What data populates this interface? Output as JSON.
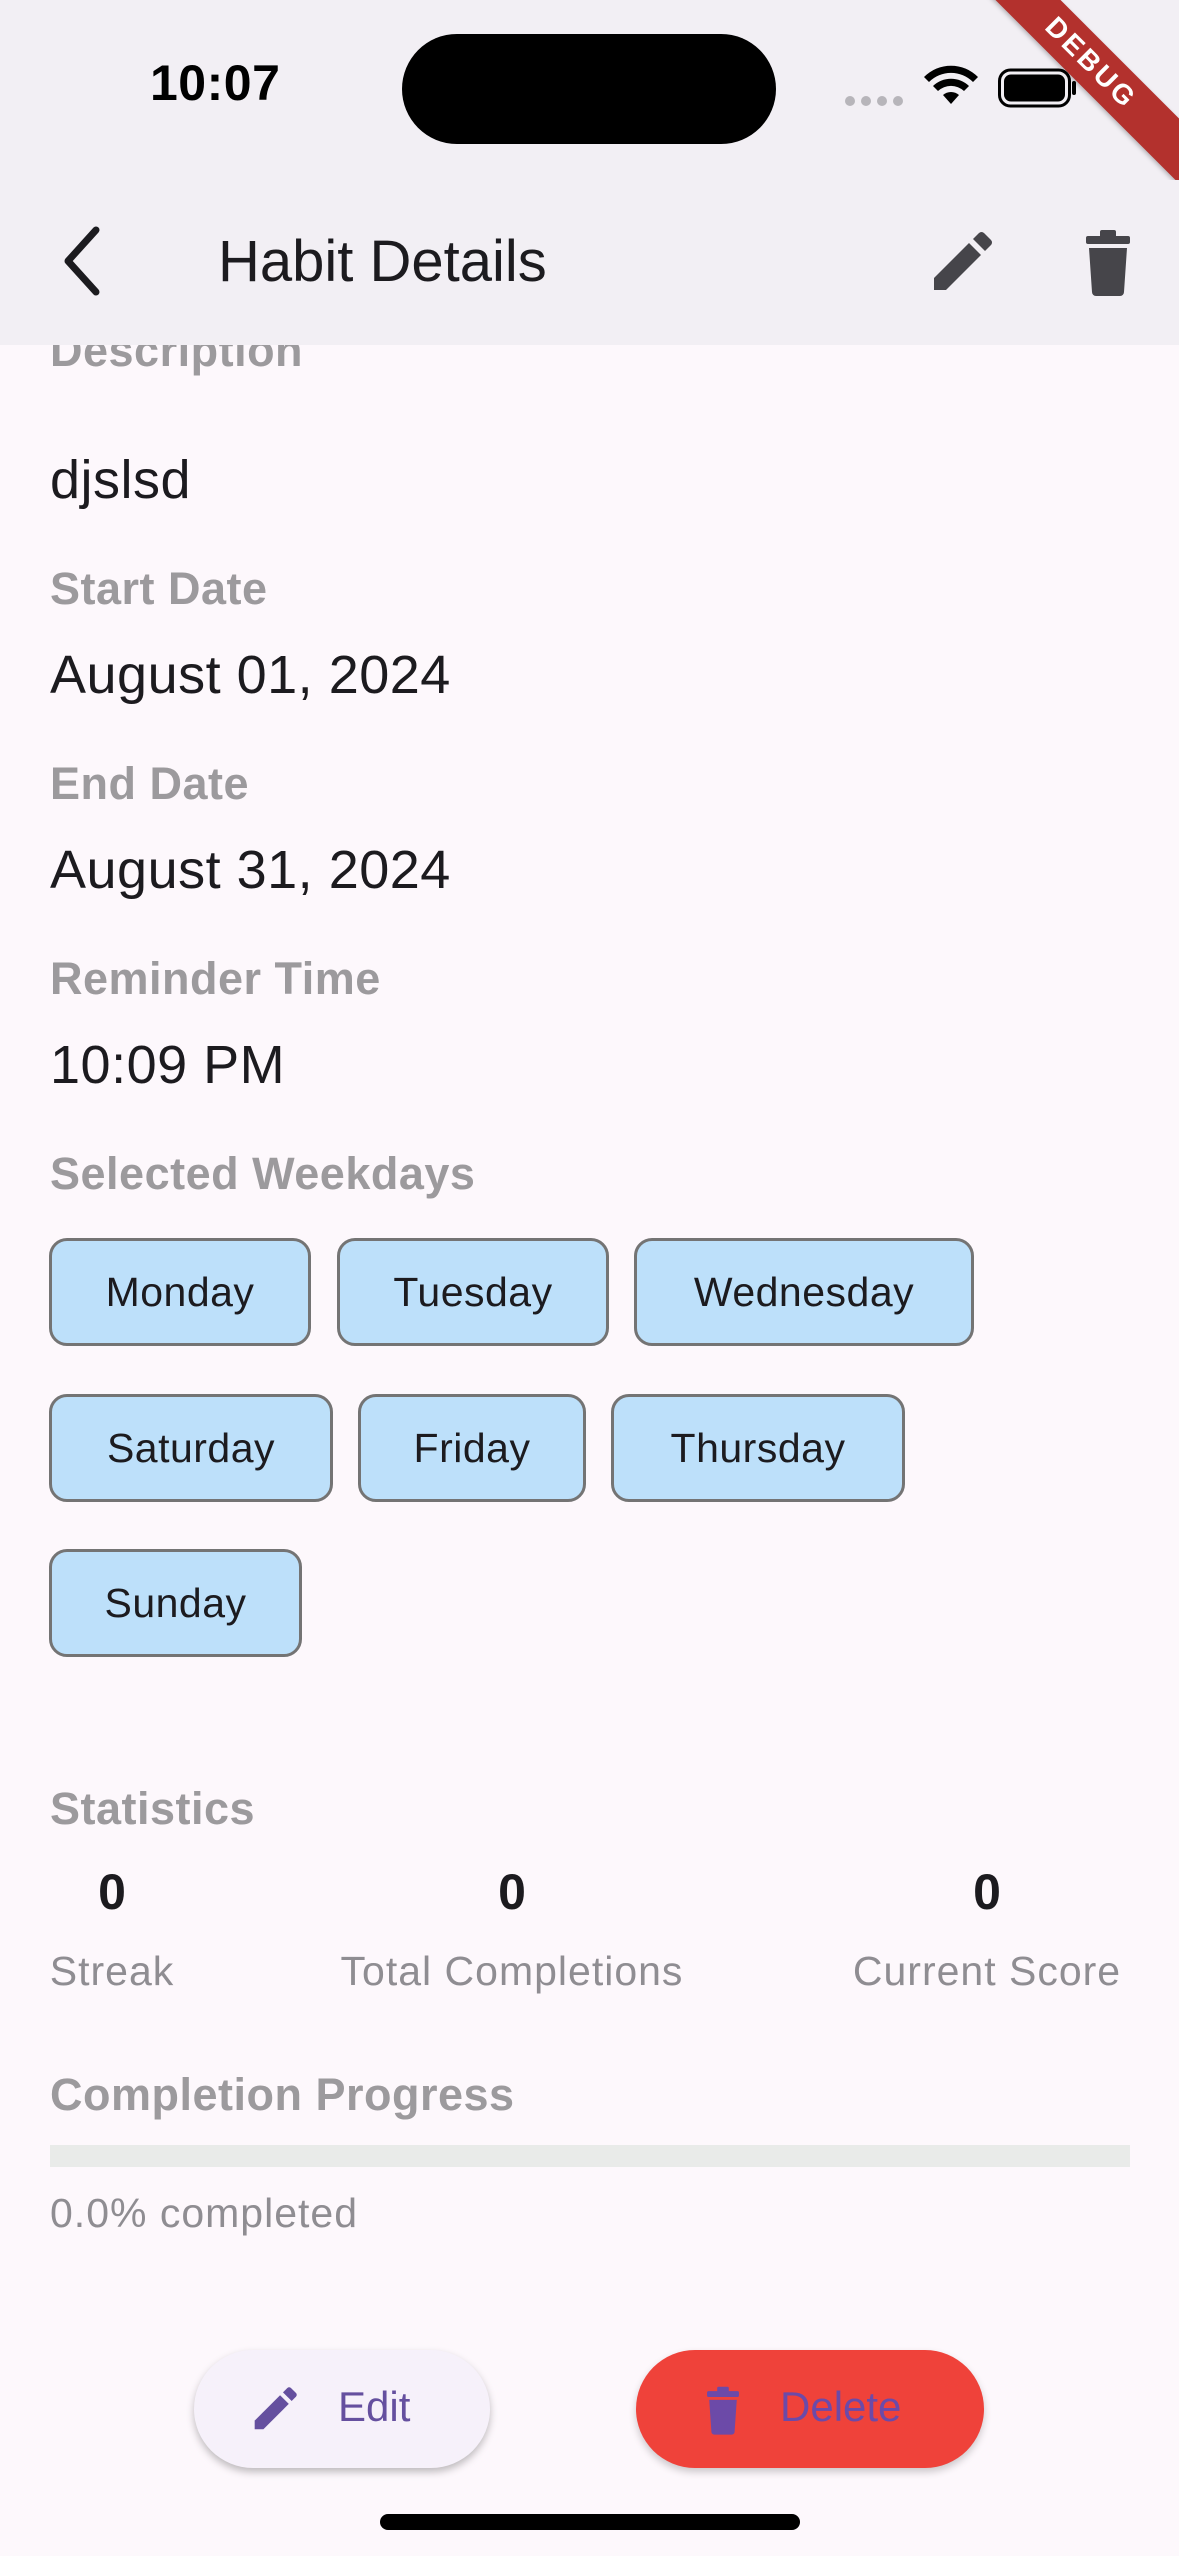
{
  "status_bar": {
    "time": "10:07",
    "debug_banner": "DEBUG"
  },
  "app_bar": {
    "title": "Habit Details",
    "icons": {
      "back": "chevron-left-icon",
      "edit": "pencil-icon",
      "delete": "trash-icon"
    }
  },
  "details": {
    "description_label": "Description",
    "description_value": "djslsd",
    "start_date_label": "Start Date",
    "start_date_value": "August 01, 2024",
    "end_date_label": "End Date",
    "end_date_value": "August 31, 2024",
    "reminder_label": "Reminder Time",
    "reminder_value": "10:09 PM",
    "weekdays_label": "Selected Weekdays",
    "weekdays": [
      "Monday",
      "Tuesday",
      "Wednesday",
      "Saturday",
      "Friday",
      "Thursday",
      "Sunday"
    ]
  },
  "statistics": {
    "label": "Statistics",
    "items": [
      {
        "value": "0",
        "label": "Streak"
      },
      {
        "value": "0",
        "label": "Total Completions"
      },
      {
        "value": "0",
        "label": "Current Score"
      }
    ]
  },
  "progress": {
    "label": "Completion Progress",
    "fraction": 0.0,
    "text": "0.0% completed"
  },
  "actions": {
    "edit_label": "Edit",
    "delete_label": "Delete"
  },
  "colors": {
    "app_bar_bg": "#f2eff4",
    "page_bg": "#fdf8fc",
    "chip_bg": "#bde0fa",
    "delete_bg": "#ef423a",
    "accent": "#65509f",
    "debug_banner": "#b3312d"
  }
}
